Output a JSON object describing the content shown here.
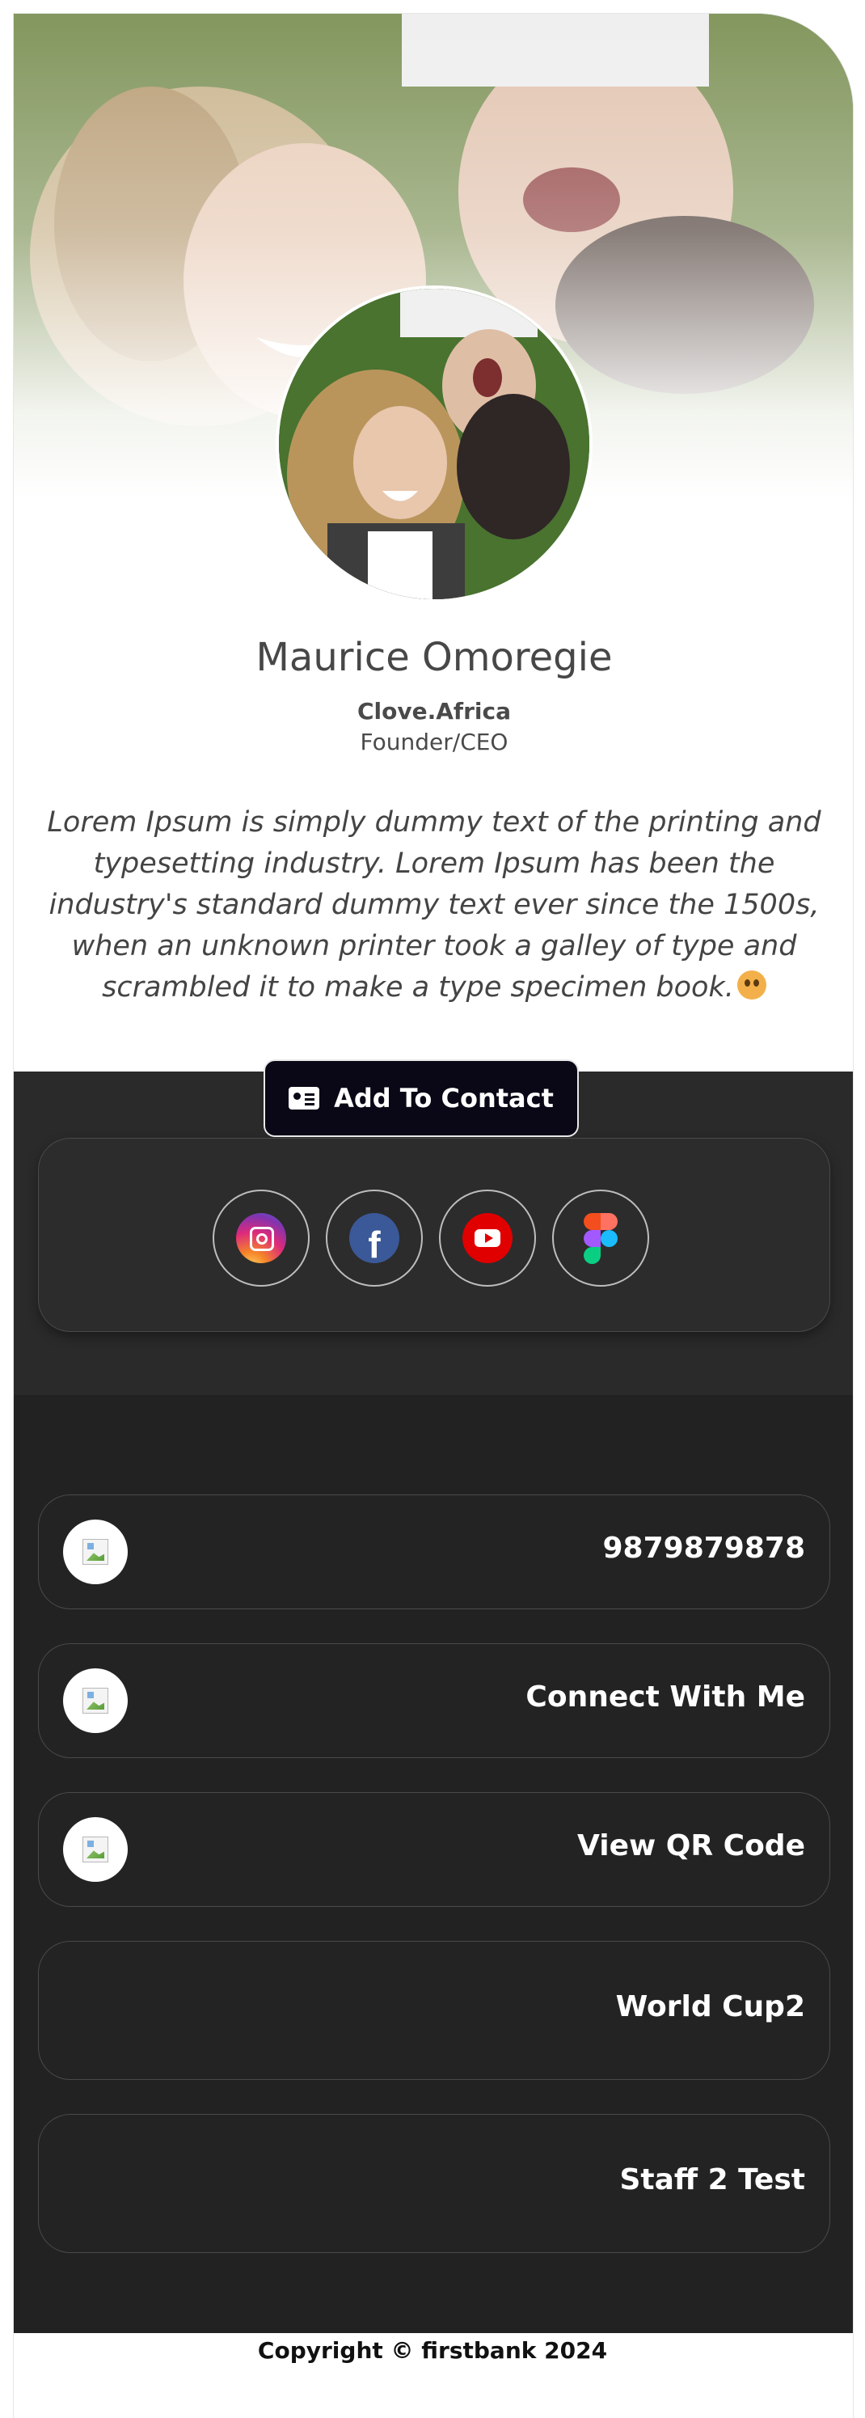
{
  "profile": {
    "name": "Maurice Omoregie",
    "company": "Clove.Africa",
    "role": "Founder/CEO",
    "bio": "Lorem Ipsum is simply dummy text of the printing and typesetting industry. Lorem Ipsum has been the industry's standard dummy text ever since the 1500s, when an unknown printer took a galley of type and scrambled it to make a type specimen book."
  },
  "actions": {
    "add_contact_label": "Add To Contact"
  },
  "social": [
    {
      "name": "Instagram",
      "icon": "instagram-icon",
      "color": "#dd2a7b"
    },
    {
      "name": "Facebook",
      "icon": "facebook-icon",
      "color": "#3b5998"
    },
    {
      "name": "YouTube",
      "icon": "youtube-icon",
      "color": "#e00000"
    },
    {
      "name": "Figma",
      "icon": "figma-icon",
      "color": "#a259ff"
    }
  ],
  "links": [
    {
      "label": "9879879878",
      "icon": "broken-image-icon"
    },
    {
      "label": "Connect With Me",
      "icon": "broken-image-icon"
    },
    {
      "label": "View QR Code",
      "icon": "broken-image-icon"
    },
    {
      "label": "World Cup2"
    },
    {
      "label": "Staff 2 Test"
    }
  ],
  "footer": {
    "copyright": "Copyright © firstbank 2024"
  },
  "theme": {
    "dark_background": "#222222",
    "social_background": "#2a2a2a",
    "button_background": "#0a0716"
  }
}
